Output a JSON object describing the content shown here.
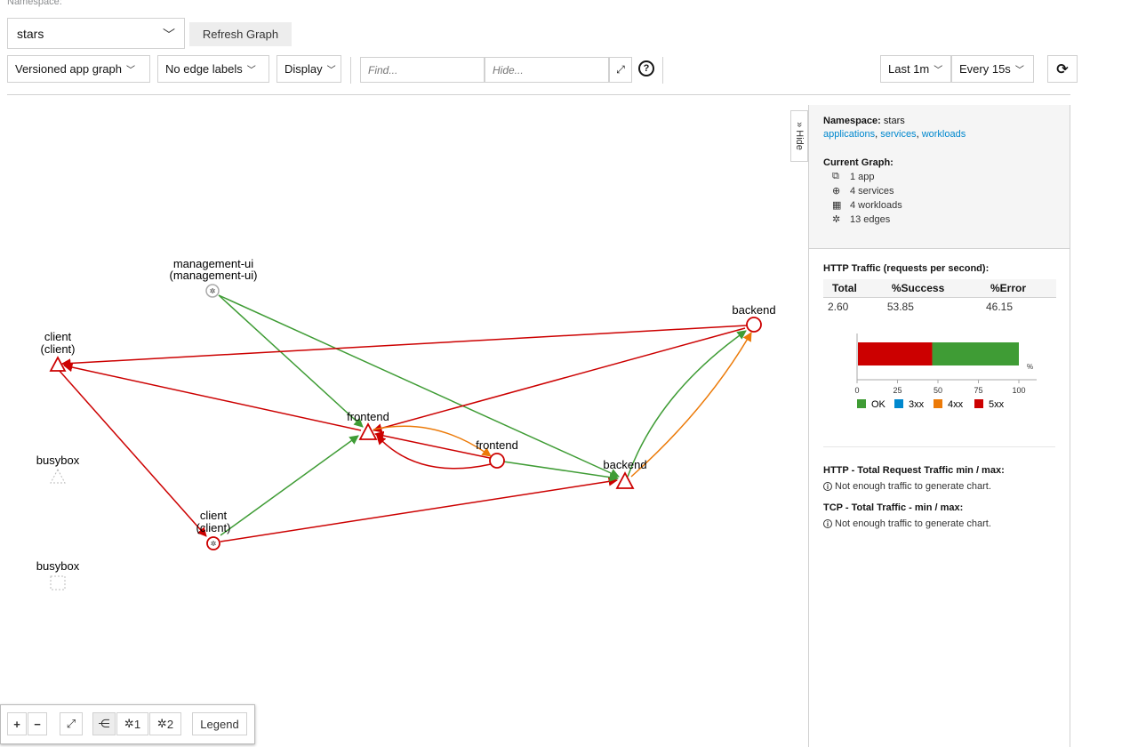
{
  "namespace_label": "Namespace:",
  "namespace_value": "stars",
  "refresh_graph": "Refresh Graph",
  "toolbar": {
    "graph_type": "Versioned app graph",
    "edge_labels": "No edge labels",
    "display": "Display",
    "find_placeholder": "Find...",
    "hide_placeholder": "Hide...",
    "help": "?",
    "duration": "Last 1m",
    "refresh_interval": "Every 15s"
  },
  "hide_tab": "» Hide",
  "side": {
    "namespace_key": "Namespace:",
    "namespace_val": "stars",
    "links": [
      "applications",
      "services",
      "workloads"
    ],
    "current_graph": "Current Graph:",
    "counts": [
      "1 app",
      "4 services",
      "4 workloads",
      "13 edges"
    ],
    "http_title": "HTTP Traffic (requests per second):",
    "headers": [
      "Total",
      "%Success",
      "%Error"
    ],
    "row": [
      "2.60",
      "53.85",
      "46.15"
    ],
    "bar": {
      "ok": 53.85,
      "3xx": 0,
      "4xx": 0,
      "5xx": 46.15
    },
    "axis_ticks": [
      "0",
      "25",
      "50",
      "75",
      "100"
    ],
    "axis_unit": "%",
    "legend": [
      "OK",
      "3xx",
      "4xx",
      "5xx"
    ],
    "colors": {
      "ok": "#3f9c35",
      "3xx": "#0088ce",
      "4xx": "#ec7a08",
      "5xx": "#cc0000"
    },
    "http_minmax": "HTTP - Total Request Traffic min / max:",
    "tcp_minmax": "TCP - Total Traffic - min / max:",
    "no_traffic": "Not enough traffic to generate chart."
  },
  "graph": {
    "nodes": {
      "mgmt": [
        "management-ui",
        "(management-ui)"
      ],
      "client_top": [
        "client",
        "(client)"
      ],
      "busybox1": "busybox",
      "busybox2": "busybox",
      "client_bottom": [
        "client",
        "(client)"
      ],
      "frontend_svc": "frontend",
      "frontend_app": "frontend",
      "backend_app": "backend",
      "backend_svc": "backend"
    }
  },
  "zoom": {
    "plus": "+",
    "minus": "−",
    "n1": "1",
    "n2": "2",
    "legend": "Legend"
  }
}
